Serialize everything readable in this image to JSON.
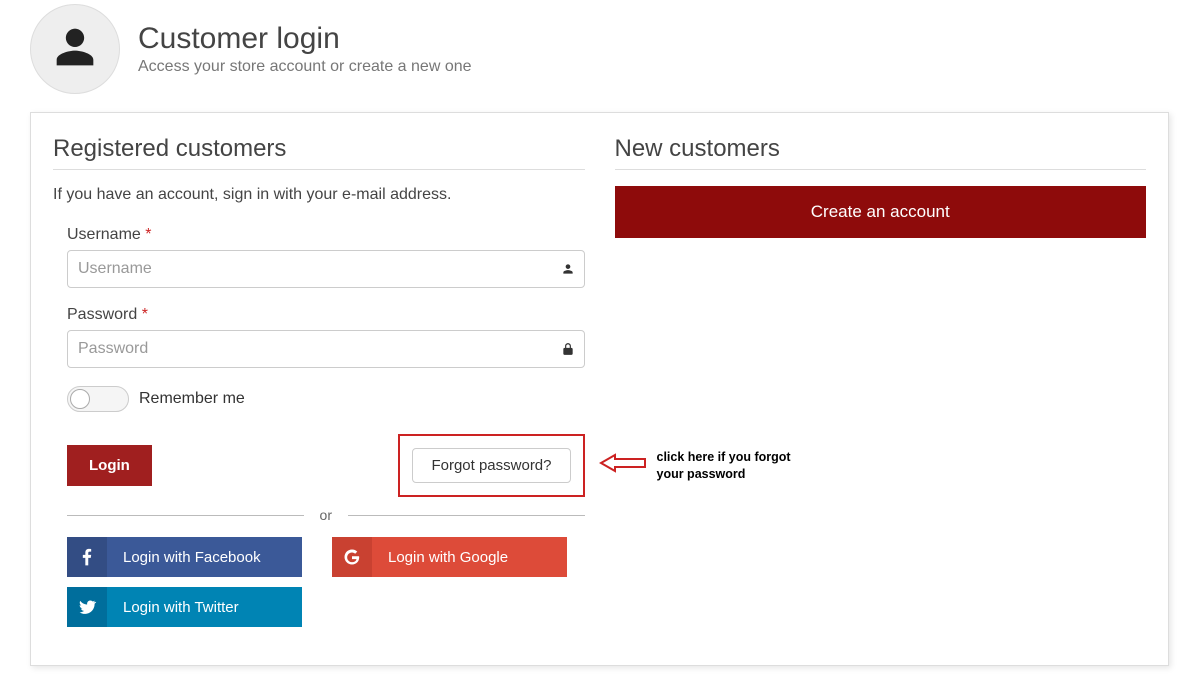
{
  "header": {
    "title": "Customer login",
    "subtitle": "Access your store account or create a new one"
  },
  "registered": {
    "heading": "Registered customers",
    "intro": "If you have an account, sign in with your e-mail address.",
    "username_label": "Username",
    "username_placeholder": "Username",
    "password_label": "Password",
    "password_placeholder": "Password",
    "required_marker": "*",
    "remember_label": "Remember me",
    "login_label": "Login",
    "forgot_label": "Forgot password?",
    "divider_label": "or",
    "social": {
      "facebook": "Login with Facebook",
      "google": "Login with Google",
      "twitter": "Login with Twitter"
    }
  },
  "annotation": {
    "forgot_note": "click here if you forgot your password"
  },
  "new": {
    "heading": "New customers",
    "create_label": "Create an account"
  },
  "colors": {
    "primary": "#a01f1f",
    "primary_dark": "#8e0b0b",
    "highlight": "#c22",
    "facebook": "#3b5998",
    "google": "#dd4b39",
    "twitter": "#0084b4"
  }
}
